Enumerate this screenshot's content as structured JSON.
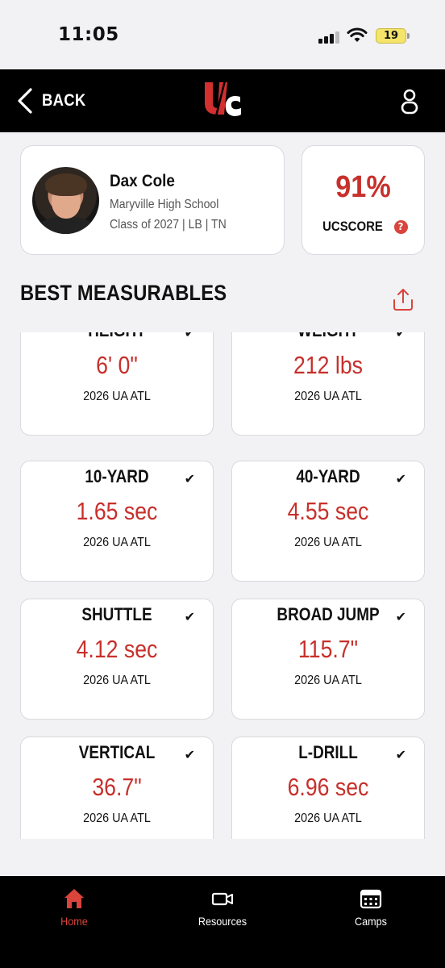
{
  "status_bar": {
    "time": "11:05",
    "battery": "19"
  },
  "header": {
    "back_label": "BACK",
    "logo_text": "UC"
  },
  "player": {
    "name": "Dax Cole",
    "school": "Maryville High School",
    "class_line": "Class of 2027 | LB | TN"
  },
  "score": {
    "value": "91%",
    "label": "UCSCORE",
    "help": "?"
  },
  "section": {
    "title": "BEST MEASURABLES"
  },
  "measurables": [
    {
      "label": "HEIGHT",
      "value": "6' 0\"",
      "event": "2026 UA ATL",
      "check": "✔"
    },
    {
      "label": "WEIGHT",
      "value": "212 lbs",
      "event": "2026 UA ATL",
      "check": "✔"
    },
    {
      "label": "10-YARD",
      "value": "1.65 sec",
      "event": "2026 UA ATL",
      "check": "✔"
    },
    {
      "label": "40-YARD",
      "value": "4.55 sec",
      "event": "2026 UA ATL",
      "check": "✔"
    },
    {
      "label": "SHUTTLE",
      "value": "4.12 sec",
      "event": "2026 UA ATL",
      "check": "✔"
    },
    {
      "label": "BROAD JUMP",
      "value": "115.7\"",
      "event": "2026 UA ATL",
      "check": "✔"
    },
    {
      "label": "VERTICAL",
      "value": "36.7\"",
      "event": "2026 UA ATL",
      "check": "✔"
    },
    {
      "label": "L-DRILL",
      "value": "6.96 sec",
      "event": "2026 UA ATL",
      "check": "✔"
    }
  ],
  "tabs": [
    {
      "label": "Home",
      "icon": "home-icon"
    },
    {
      "label": "Resources",
      "icon": "video-icon"
    },
    {
      "label": "Camps",
      "icon": "calendar-icon"
    }
  ],
  "colors": {
    "accent": "#c7302b",
    "header_bg": "#000000",
    "page_bg": "#f2f2f5"
  }
}
